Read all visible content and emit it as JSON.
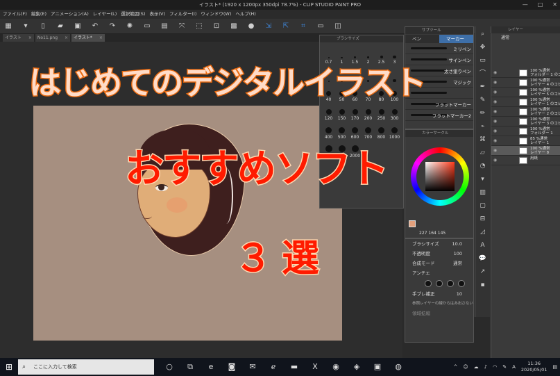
{
  "window": {
    "title": "イラスト* (1920 x 1200px 350dpi 78.7%) - CLIP STUDIO PAINT PRO",
    "minimize": "—",
    "maximize": "□",
    "close": "✕"
  },
  "menu": [
    "ファイル(F)",
    "編集(E)",
    "アニメーション(A)",
    "レイヤー(L)",
    "選択範囲(S)",
    "表示(V)",
    "フィルター(I)",
    "ウィンドウ(W)",
    "ヘルプ(H)"
  ],
  "doc_tabs": [
    {
      "label": "イラスト"
    },
    {
      "label": "No11.png"
    },
    {
      "label": "イラスト*"
    }
  ],
  "brush_size_palette": {
    "title": "ブラシサイズ",
    "sizes": [
      "0.7",
      "1",
      "1.5",
      "2",
      "2.5",
      "3",
      "",
      "",
      "",
      "",
      "",
      "",
      "40",
      "50",
      "60",
      "70",
      "80",
      "100",
      "120",
      "150",
      "170",
      "200",
      "250",
      "300",
      "400",
      "500",
      "600",
      "700",
      "800",
      "1000",
      "1500",
      "1700",
      "2000",
      "",
      "",
      ""
    ]
  },
  "sub_tool": {
    "title": "サブツール",
    "tabs": [
      "ペン",
      "マーカー"
    ],
    "items": [
      "ミリペン",
      "サインペン",
      "太さ塗りペン",
      "マジック",
      "",
      "フラットマーカー",
      "フラットマーカー2"
    ]
  },
  "color_circle": {
    "title": "カラーサークル",
    "r": "227",
    "g": "164",
    "b": "145"
  },
  "tool_property": {
    "brush_size_label": "ブラシサイズ",
    "brush_size_value": "10.0",
    "opacity_label": "不透明度",
    "opacity_value": "100",
    "blend_label": "合成モード",
    "blend_value": "通常",
    "aa_label": "アンチエ",
    "stabilize_label": "手ブレ補正",
    "stabilize_value": "10",
    "ref_layer_label": "参照レイヤーの線からはみ出さない",
    "area_label": "領域拡縮"
  },
  "layers": {
    "title": "レイヤー",
    "blend": "通常",
    "items": [
      {
        "line1": "100 %通常",
        "line2": "フォルダー 1 のコピー"
      },
      {
        "line1": "100 %通常",
        "line2": "レイヤー 4 のコピー"
      },
      {
        "line1": "100 %通常",
        "line2": "レイヤー 5 のコピー"
      },
      {
        "line1": "100 %通常",
        "line2": "レイヤー 1 のコピー"
      },
      {
        "line1": "100 %通常",
        "line2": "レイヤー 2 のコピー"
      },
      {
        "line1": "100 %通常",
        "line2": "レイヤー 3 のコピー"
      },
      {
        "line1": "100 %通常",
        "line2": "フォルダー 1"
      },
      {
        "line1": "85 %通常",
        "line2": "レイヤー 1"
      },
      {
        "line1": "100 %通常",
        "line2": "レイヤー 8"
      },
      {
        "line1": "",
        "line2": "用紙"
      }
    ]
  },
  "overlay": {
    "line1": "はじめてのデジタルイラスト",
    "line2": "おすすめソフト",
    "line3": "３選"
  },
  "taskbar": {
    "search_placeholder": "ここに入力して検索",
    "time": "11:36",
    "date": "2020/05/01"
  }
}
